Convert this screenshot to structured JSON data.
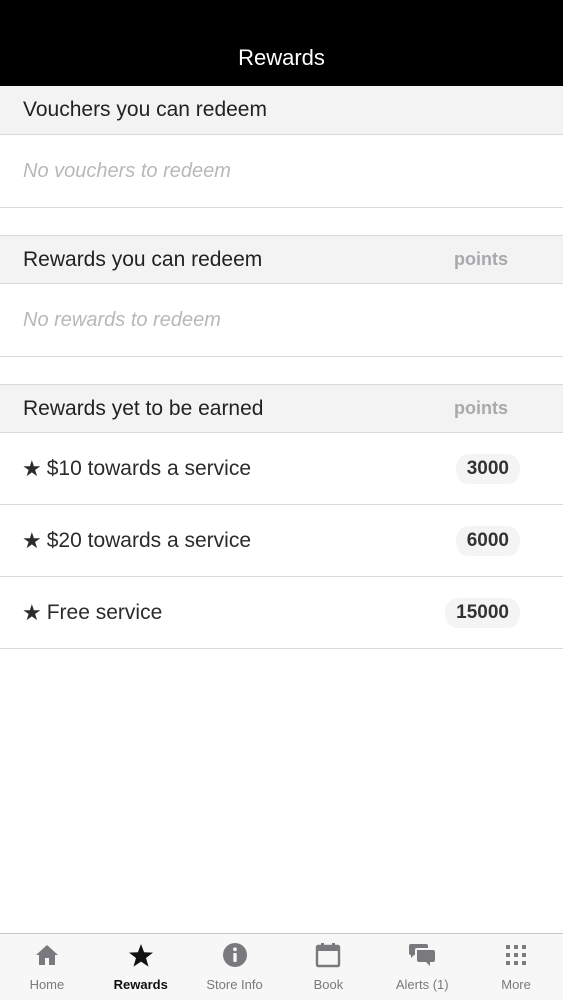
{
  "header": {
    "title": "Rewards"
  },
  "vouchers": {
    "title": "Vouchers you can redeem",
    "empty": "No vouchers to redeem"
  },
  "redeemable": {
    "title": "Rewards you can redeem",
    "points_label": "points",
    "empty": "No rewards to redeem"
  },
  "unearned": {
    "title": "Rewards yet to be earned",
    "points_label": "points",
    "items": [
      {
        "star": "★",
        "label": "$10 towards a service",
        "points": "3000"
      },
      {
        "star": "★",
        "label": "$20 towards a service",
        "points": "6000"
      },
      {
        "star": "★",
        "label": "Free service",
        "points": "15000"
      }
    ]
  },
  "tabs": [
    {
      "label": "Home",
      "icon": "home-icon"
    },
    {
      "label": "Rewards",
      "icon": "star-icon",
      "active": true
    },
    {
      "label": "Store Info",
      "icon": "info-icon"
    },
    {
      "label": "Book",
      "icon": "calendar-icon"
    },
    {
      "label": "Alerts (1)",
      "icon": "chat-bubbles-icon"
    },
    {
      "label": "More",
      "icon": "grid-dots-icon"
    }
  ]
}
